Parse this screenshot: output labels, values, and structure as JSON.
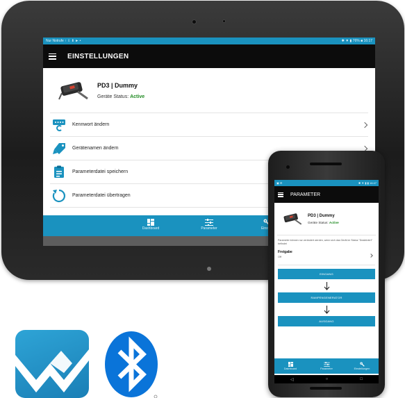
{
  "tablet": {
    "status_left": "Nur Notrufe ↑ ⇩ ⬇ ► •",
    "status_right": "✱ ▼ ▮ 76% ■ 16:17",
    "title": "EINSTELLUNGEN",
    "device": {
      "name": "PD3 | Dummy",
      "status_label": "Geräte Status:",
      "status_value": "Active"
    },
    "menu_items": [
      {
        "label": "Kennwort ändern",
        "icon": "password-icon"
      },
      {
        "label": "Gerätenamen ändern",
        "icon": "tag-icon"
      },
      {
        "label": "Parameterdatei speichern",
        "icon": "clipboard-icon"
      },
      {
        "label": "Parameterdatei übertragen",
        "icon": "refresh-icon"
      }
    ],
    "bottom_nav": [
      {
        "label": "Dashboard",
        "icon": "dashboard-icon"
      },
      {
        "label": "Parameter",
        "icon": "sliders-icon"
      },
      {
        "label": "Einstell",
        "icon": "settings-icon"
      }
    ]
  },
  "phone": {
    "status_left": "▣ ⚙",
    "status_right": "✱ ▼ ▮ ▮ 16:47",
    "title": "PARAMETER",
    "device": {
      "name": "PD3 | Dummy",
      "status_label": "Geräte Status:",
      "status_value": "Active"
    },
    "description": "Parameter können nur verändert werden, wenn sich das Gerät im Status \"Deaktiviert\" befindet",
    "freigabe": {
      "label": "Freigabe",
      "value": "Off"
    },
    "buttons": [
      "EINGANG",
      "RAMPENGENERATOR",
      "AUSGANG"
    ],
    "bottom_nav": [
      {
        "label": "Dashboard",
        "icon": "dashboard-icon"
      },
      {
        "label": "Parameter",
        "icon": "sliders-icon"
      },
      {
        "label": "Einstellungen",
        "icon": "settings-icon"
      }
    ],
    "system_nav": [
      "◁",
      "○",
      "□"
    ]
  },
  "colors": {
    "accent": "#1a92bf",
    "appbar": "#0c0c0c",
    "active": "#1f8a21",
    "bluetooth": "#0a74d9"
  }
}
